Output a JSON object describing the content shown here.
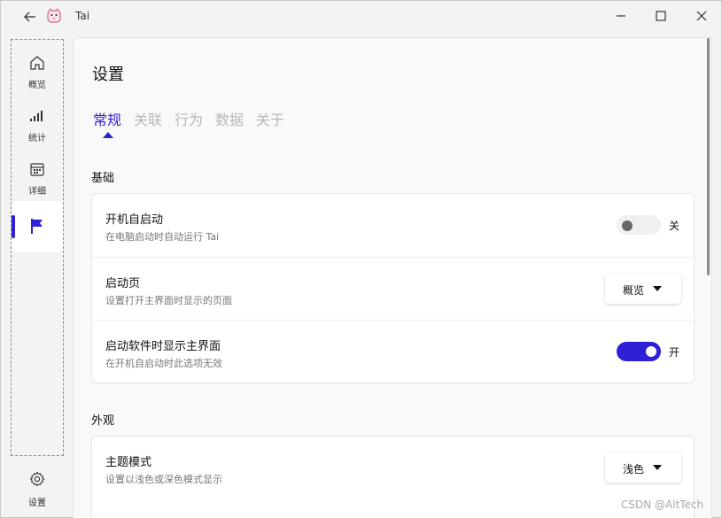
{
  "app": {
    "title": "Tai"
  },
  "sidebar": {
    "items": [
      {
        "label": "概览",
        "icon": "home-icon"
      },
      {
        "label": "统计",
        "icon": "signal-bars-icon"
      },
      {
        "label": "详细",
        "icon": "calendar-icon"
      },
      {
        "label": "",
        "icon": "flag-icon",
        "active": true
      }
    ],
    "settings": {
      "label": "设置",
      "icon": "gear-icon"
    }
  },
  "page": {
    "title": "设置",
    "tabs": [
      "常规",
      "关联",
      "行为",
      "数据",
      "关于"
    ],
    "active_tab": "常规"
  },
  "sections": {
    "basic": {
      "title": "基础",
      "rows": [
        {
          "title": "开机自启动",
          "desc": "在电脑启动时自动运行 Tai",
          "control": "toggle",
          "state": "off",
          "state_label": "关"
        },
        {
          "title": "启动页",
          "desc": "设置打开主界面时显示的页面",
          "control": "dropdown",
          "value": "概览"
        },
        {
          "title": "启动软件时显示主界面",
          "desc": "在开机自启动时此选项无效",
          "control": "toggle",
          "state": "on",
          "state_label": "开"
        }
      ]
    },
    "appearance": {
      "title": "外观",
      "rows": [
        {
          "title": "主题模式",
          "desc": "设置以浅色或深色模式显示",
          "control": "dropdown",
          "value": "浅色"
        }
      ]
    }
  },
  "colors": {
    "accent": "#2f1fd6"
  },
  "watermark": "CSDN @AltTech"
}
